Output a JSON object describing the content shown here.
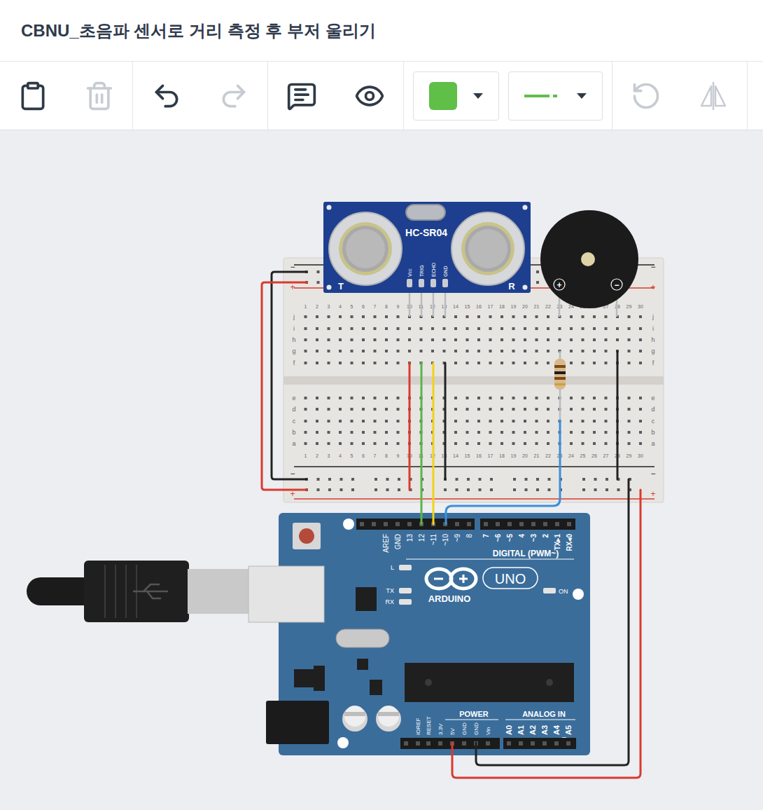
{
  "window": {
    "title": "CBNU_초음파 센서로 거리 측정 후 부저 울리기"
  },
  "toolbar": {
    "buttons": [
      {
        "disabled": false
      },
      {
        "disabled": true
      },
      {
        "disabled": false
      },
      {
        "disabled": true
      },
      {
        "disabled": false
      },
      {
        "disabled": false
      },
      {
        "disabled": true
      },
      {
        "disabled": true
      }
    ],
    "fill_color": "#5fbf47",
    "line_color": "#5fbf47"
  },
  "sensor": {
    "model": "HC-SR04",
    "pins": [
      "Vcc",
      "TRIG",
      "ECHO",
      "GND"
    ],
    "transmitter": "T",
    "receiver": "R"
  },
  "buzzer": {
    "plus": "+",
    "minus": "−"
  },
  "breadboard": {
    "columns": [
      "1",
      "2",
      "3",
      "4",
      "5",
      "6",
      "7",
      "8",
      "9",
      "10",
      "11",
      "12",
      "13",
      "14",
      "15",
      "16",
      "17",
      "18",
      "19",
      "20",
      "21",
      "22",
      "23",
      "24",
      "25",
      "26",
      "27",
      "28",
      "29",
      "30"
    ],
    "top_rows": [
      "j",
      "i",
      "h",
      "g",
      "f"
    ],
    "bottom_rows": [
      "e",
      "d",
      "c",
      "b",
      "a"
    ],
    "rails": [
      "−",
      "+"
    ]
  },
  "wires": [
    {
      "color": "#222222"
    },
    {
      "color": "#d93a2f"
    },
    {
      "color": "#d93a2f"
    },
    {
      "color": "#5cb34a"
    },
    {
      "color": "#f2d21b"
    },
    {
      "color": "#222222"
    },
    {
      "color": "#3a8fd9"
    },
    {
      "color": "#222222"
    },
    {
      "color": "#d93a2f"
    },
    {
      "color": "#222222"
    }
  ],
  "arduino": {
    "digital_left": [
      "AREF",
      "GND",
      "13",
      "12",
      "~11",
      "~10",
      "~9",
      "8"
    ],
    "digital_right": [
      "7",
      "~6",
      "~5",
      "4",
      "~3",
      "2",
      "TX▸1",
      "RX◂0"
    ],
    "digital_title": "DIGITAL (PWM~)",
    "leds": [
      "L",
      "TX",
      "RX"
    ],
    "on_label": "ON",
    "brand": "ARDUINO",
    "model": "UNO",
    "power_title": "POWER",
    "power_pins": [
      "IOREF",
      "RESET",
      "3.3V",
      "5V",
      "GND",
      "GND",
      "Vin"
    ],
    "analog_title": "ANALOG IN",
    "analog_pins": [
      "A0",
      "A1",
      "A2",
      "A3",
      "A4",
      "A5"
    ]
  }
}
